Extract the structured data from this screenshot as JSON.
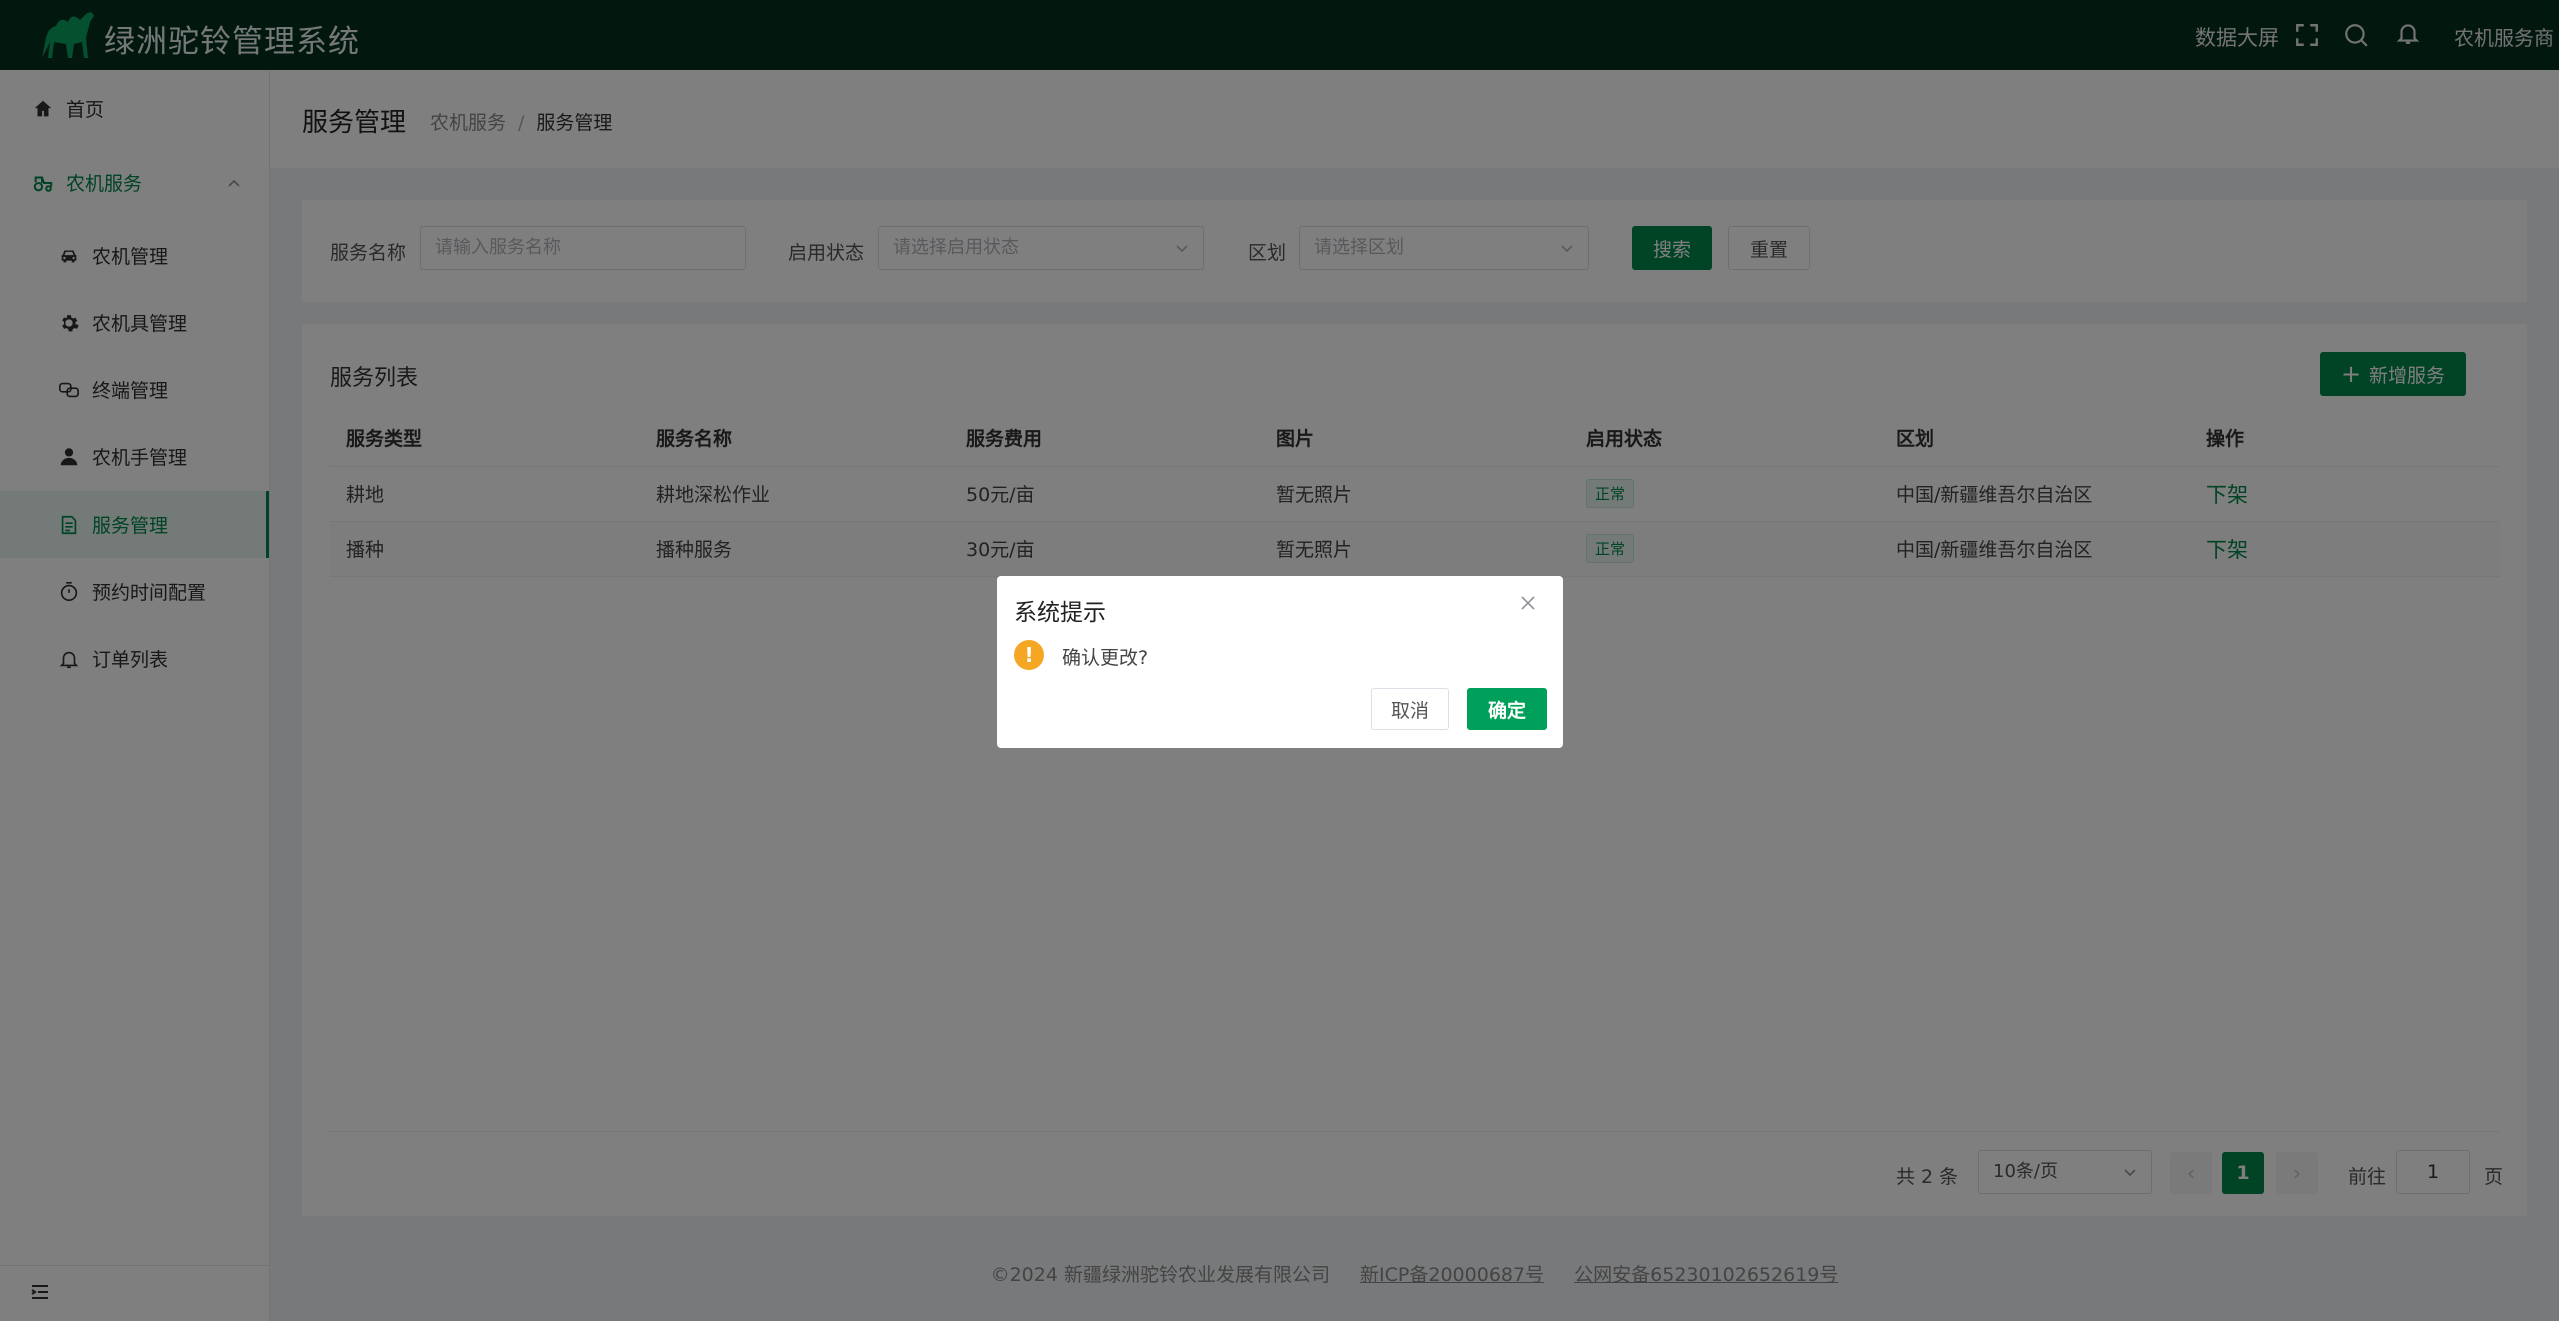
{
  "app": {
    "title": "绿洲驼铃管理系统"
  },
  "header": {
    "data_screen": "数据大屏",
    "user": "农机服务商"
  },
  "sidebar": {
    "home": "首页",
    "group": "农机服务",
    "items": [
      "农机管理",
      "农机具管理",
      "终端管理",
      "农机手管理",
      "服务管理",
      "预约时间配置",
      "订单列表"
    ]
  },
  "page": {
    "title": "服务管理",
    "breadcrumb": [
      "农机服务",
      "服务管理"
    ]
  },
  "filter": {
    "name_label": "服务名称",
    "name_placeholder": "请输入服务名称",
    "status_label": "启用状态",
    "status_placeholder": "请选择启用状态",
    "region_label": "区划",
    "region_placeholder": "请选择区划",
    "search": "搜索",
    "reset": "重置"
  },
  "list": {
    "title": "服务列表",
    "add": "新增服务",
    "columns": [
      "服务类型",
      "服务名称",
      "服务费用",
      "图片",
      "启用状态",
      "区划",
      "操作"
    ],
    "rows": [
      {
        "type": "耕地",
        "name": "耕地深松作业",
        "fee": "50元/亩",
        "image": "暂无照片",
        "status": "正常",
        "region": "中国/新疆维吾尔自治区",
        "action": "下架"
      },
      {
        "type": "播种",
        "name": "播种服务",
        "fee": "30元/亩",
        "image": "暂无照片",
        "status": "正常",
        "region": "中国/新疆维吾尔自治区",
        "action": "下架"
      }
    ]
  },
  "pagination": {
    "total": "共 2 条",
    "page_size": "10条/页",
    "current": "1",
    "goto": "前往",
    "goto_value": "1",
    "page_unit": "页",
    "prev": "‹",
    "next": "›"
  },
  "footer": {
    "copyright": "©2024 新疆绿洲驼铃农业发展有限公司",
    "icp": "新ICP备20000687号",
    "police": "公网安备65230102652619号"
  },
  "dialog": {
    "title": "系统提示",
    "message": "确认更改?",
    "cancel": "取消",
    "confirm": "确定",
    "warn": "!"
  },
  "colors": {
    "primary": "#00864a",
    "header_bg": "#04311f",
    "warning": "#f5a623"
  }
}
